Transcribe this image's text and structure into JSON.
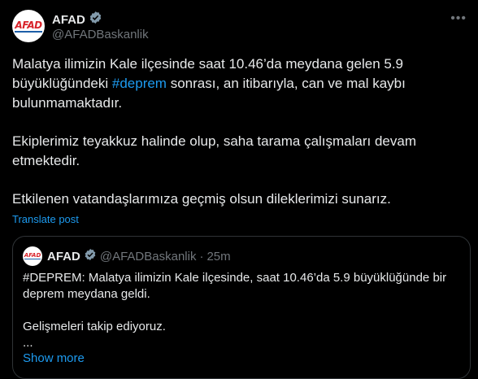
{
  "author": {
    "logo_text": "AFAD",
    "name": "AFAD",
    "handle": "@AFADBaskanlik",
    "verified_color": "#829aab"
  },
  "more_icon": "more-horizontal-icon",
  "tweet": {
    "p1_before": "Malatya ilimizin Kale ilçesinde saat 10.46’da meydana gelen 5.9 büyüklüğündeki ",
    "p1_hashtag": "#deprem",
    "p1_after": " sonrası, an itibarıyla, can ve mal kaybı bulunmamaktadır.",
    "p2": "Ekiplerimiz teyakkuz halinde olup, saha tarama çalışmaları devam etmektedir.",
    "p3": "Etkilenen vatandaşlarımıza geçmiş olsun dileklerimizi sunarız."
  },
  "translate_label": "Translate post",
  "quote": {
    "logo_text": "AFAD",
    "name": "AFAD",
    "handle": "@AFADBaskanlik",
    "separator": "·",
    "time": "25m",
    "p1": "#DEPREM: Malatya ilimizin Kale ilçesinde, saat 10.46’da 5.9 büyüklüğünde bir deprem meydana geldi.",
    "p2": "Gelişmeleri takip ediyoruz.",
    "p3": "...",
    "show_more": "Show more"
  },
  "colors": {
    "link": "#1d9bf0",
    "muted": "#71767b",
    "brand_red": "#d8232a",
    "background": "#000000"
  }
}
